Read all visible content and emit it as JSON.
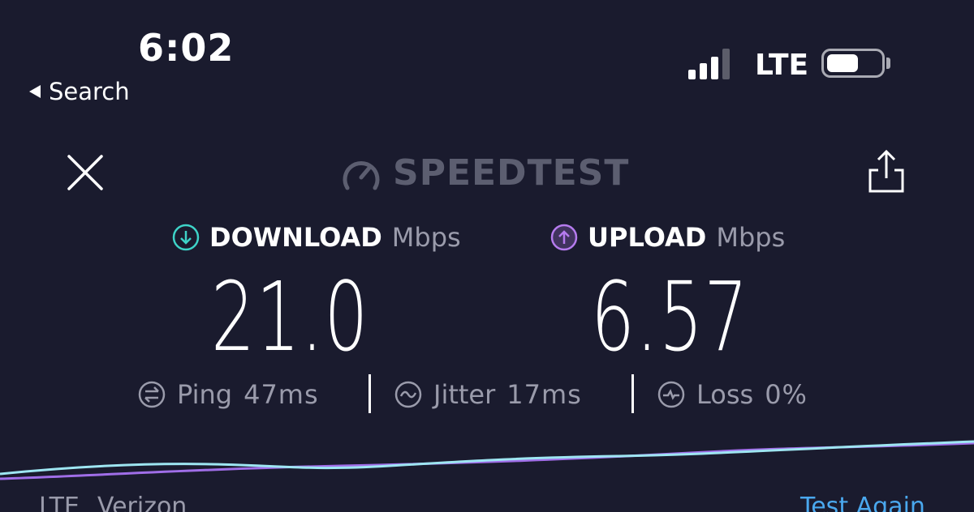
{
  "status_bar": {
    "time": "6:02",
    "back_label": "Search",
    "network": "LTE",
    "battery_level": 0.6
  },
  "header": {
    "brand": "SPEEDTEST"
  },
  "download": {
    "label": "DOWNLOAD",
    "unit": "Mbps",
    "value": "21.0",
    "accent": "#3ed3c8"
  },
  "upload": {
    "label": "UPLOAD",
    "unit": "Mbps",
    "value": "6.57",
    "accent": "#b57bee"
  },
  "stats": {
    "ping_label": "Ping",
    "ping_value": "47",
    "ping_unit": "ms",
    "jitter_label": "Jitter",
    "jitter_value": "17",
    "jitter_unit": "ms",
    "loss_label": "Loss",
    "loss_value": "0",
    "loss_unit": "%"
  },
  "footer": {
    "network": "LTE",
    "carrier": "Verizon",
    "test_again_label": "Test Again"
  },
  "icons": {
    "close": "close-icon",
    "brand": "speedometer-icon",
    "share": "share-icon",
    "download": "download-arrow-icon",
    "upload": "upload-arrow-icon",
    "ping": "ping-icon",
    "jitter": "jitter-icon",
    "loss": "loss-icon"
  },
  "colors": {
    "background": "#1a1b2e",
    "download_line": "#9ee6f2",
    "upload_line": "#a06ee8",
    "link": "#4aa8ee"
  }
}
